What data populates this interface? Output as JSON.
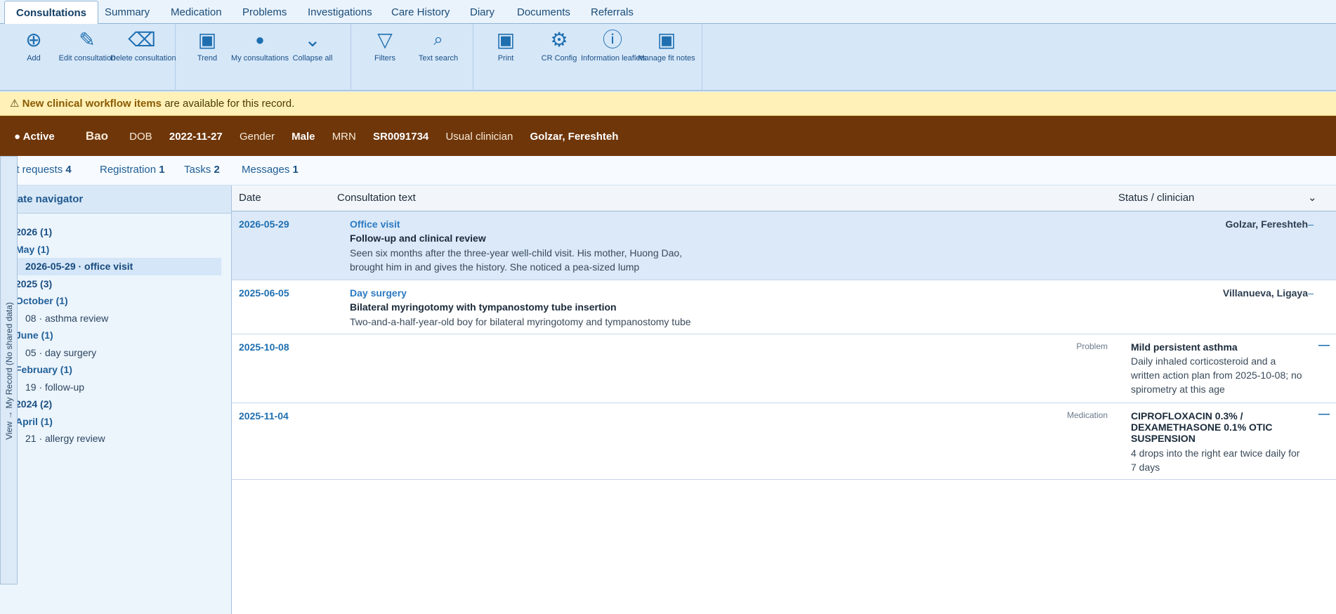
{
  "tabs": [
    {
      "label": "Consultations",
      "active": true
    },
    {
      "label": "Summary"
    },
    {
      "label": "Medication"
    },
    {
      "label": "Problems"
    },
    {
      "label": "Investigations"
    },
    {
      "label": "Care History"
    },
    {
      "label": "Diary"
    },
    {
      "label": "Documents"
    },
    {
      "label": "Referrals"
    }
  ],
  "ribbon": {
    "add": {
      "icon": "plus-circle-icon",
      "label": "Add"
    },
    "edit": {
      "icon": "pencil-icon",
      "label": "Edit consultation"
    },
    "delete": {
      "icon": "delete-icon",
      "label": "Delete consultation"
    },
    "trend": {
      "icon": "trend-icon",
      "label": "Trend"
    },
    "my": {
      "icon": "dot-icon",
      "label": "My consultations"
    },
    "collapse": {
      "icon": "chevron-down-icon",
      "label": "Collapse all"
    },
    "filters": {
      "icon": "filter-icon",
      "label": "Filters"
    },
    "search": {
      "icon": "search-icon",
      "label": "Text search"
    },
    "print": {
      "icon": "print-icon",
      "label": "Print"
    },
    "crconfig": {
      "icon": "gear-icon",
      "label": "CR Config"
    },
    "leaflets": {
      "icon": "info-icon",
      "label": "Information leaflets"
    },
    "fitnotes": {
      "icon": "notes-icon",
      "label": "Manage fit notes"
    }
  },
  "alert": {
    "strong": "New clinical workflow items",
    "rest": "are available for this record."
  },
  "patient": {
    "status": "Active",
    "name": "Bao",
    "dob_label": "DOB",
    "dob": "2022-11-27",
    "gender_label": "Gender",
    "gender": "Male",
    "mrn_label": "MRN",
    "mrn": "SR0091734",
    "clinician_label": "Usual clinician",
    "clinician": "Golzar, Fereshteh"
  },
  "strip": [
    {
      "label": "Test requests",
      "count": "4"
    },
    {
      "label": "Registration",
      "count": "1"
    },
    {
      "label": "Tasks",
      "count": "2"
    },
    {
      "label": "Messages",
      "count": "1"
    }
  ],
  "side_tab": "View → My Record (No shared data)",
  "navigator": {
    "title": "Date navigator",
    "tree": [
      {
        "kind": "year",
        "text": "2026 (1)"
      },
      {
        "kind": "month",
        "text": "May (1)"
      },
      {
        "kind": "leaf",
        "text": "2026-05-29 · office visit",
        "selected": true
      },
      {
        "kind": "year",
        "text": "2025 (3)"
      },
      {
        "kind": "month",
        "text": "October (1)"
      },
      {
        "kind": "leaf",
        "text": "08 · asthma review"
      },
      {
        "kind": "month",
        "text": "June (1)"
      },
      {
        "kind": "leaf",
        "text": "05 · day surgery"
      },
      {
        "kind": "month",
        "text": "February (1)"
      },
      {
        "kind": "leaf",
        "text": "19 · follow-up"
      },
      {
        "kind": "year",
        "text": "2024 (2)"
      },
      {
        "kind": "month",
        "text": "April (1)"
      },
      {
        "kind": "leaf",
        "text": "21 · allergy review"
      }
    ]
  },
  "grid": {
    "headers": {
      "date": "Date",
      "text": "Consultation text",
      "status": "Status / clinician",
      "toggle": "⌄"
    },
    "consultations": [
      {
        "date": "2026-05-29",
        "type": "Office visit",
        "title": "Follow-up and clinical review",
        "desc": "Seen six months after the three-year well-child visit. His mother, Huong Dao, brought him in and gives the history. She noticed a pea-sized lump",
        "clinician": "Golzar, Fereshteh",
        "dash": "–"
      },
      {
        "date": "2025-06-05",
        "type": "Day surgery",
        "title": "Bilateral myringotomy with tympanostomy tube insertion",
        "desc": "Two-and-a-half-year-old boy for bilateral myringotomy and tympanostomy tube",
        "clinician": "Villanueva, Ligaya",
        "dash": "–"
      }
    ],
    "entries": [
      {
        "date": "2025-10-08",
        "kind": "Problem",
        "title": "Mild persistent asthma",
        "desc": "Daily inhaled corticosteroid and a written action plan from 2025-10-08; no spirometry at this age",
        "dash": "—"
      },
      {
        "date": "2025-11-04",
        "kind": "Medication",
        "title": "CIPROFLOXACIN 0.3% / DEXAMETHASONE 0.1% OTIC SUSPENSION",
        "desc": "4 drops into the right ear twice daily for 7 days",
        "dash": "—"
      }
    ]
  }
}
